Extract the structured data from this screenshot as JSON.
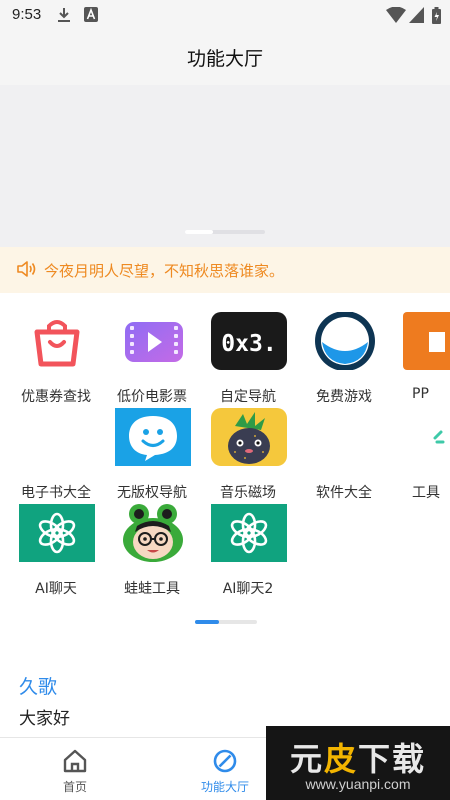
{
  "status_bar": {
    "time": "9:53"
  },
  "header": {
    "title": "功能大厅"
  },
  "notice": {
    "text": "今夜月明人尽望，不知秋思落谁家。"
  },
  "grid": {
    "items": [
      {
        "label": "优惠券查找",
        "icon": "shopping-bag-icon"
      },
      {
        "label": "低价电影票",
        "icon": "film-icon"
      },
      {
        "label": "自定导航",
        "icon": "0x3-icon",
        "text": "0x3."
      },
      {
        "label": "免费游戏",
        "icon": "game-bowl-icon"
      },
      {
        "label": "PP",
        "icon": "pp-icon"
      },
      {
        "label": "电子书大全",
        "icon": ""
      },
      {
        "label": "无版权导航",
        "icon": "smiley-chat-icon"
      },
      {
        "label": "音乐磁场",
        "icon": "strawberry-icon"
      },
      {
        "label": "软件大全",
        "icon": ""
      },
      {
        "label": "工具",
        "icon": "tool-icon"
      },
      {
        "label": "AI聊天",
        "icon": "openai-icon"
      },
      {
        "label": "蛙蛙工具",
        "icon": "frog-icon"
      },
      {
        "label": "AI聊天2",
        "icon": "openai-icon"
      }
    ]
  },
  "poem": {
    "title": "久歌",
    "body": "大家好"
  },
  "tabbar": {
    "home_label": "首页",
    "hall_label": "功能大厅"
  },
  "colors": {
    "accent": "#2f8bea",
    "notice": "#ee8a22",
    "notice_bg": "#fdf5e6"
  },
  "watermark": {
    "title_1": "元",
    "title_2": "皮",
    "title_3": "下载",
    "url": "www.yuanpi.com"
  }
}
